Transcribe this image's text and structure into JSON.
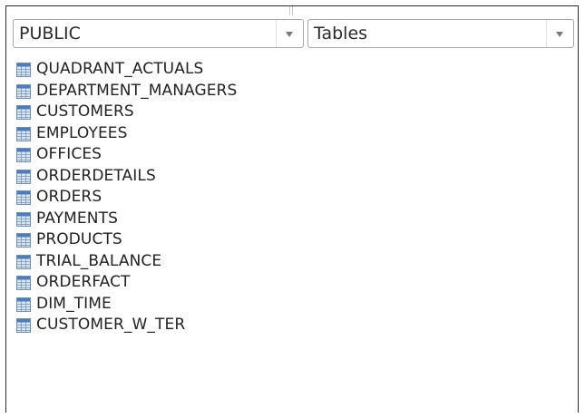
{
  "schema_select": {
    "value": "PUBLIC",
    "arrow_icon": "dropdown-arrow-icon"
  },
  "type_select": {
    "value": "Tables",
    "arrow_icon": "dropdown-arrow-icon"
  },
  "table_icon": "table-icon",
  "tables": [
    {
      "name": "QUADRANT_ACTUALS"
    },
    {
      "name": "DEPARTMENT_MANAGERS"
    },
    {
      "name": "CUSTOMERS"
    },
    {
      "name": "EMPLOYEES"
    },
    {
      "name": "OFFICES"
    },
    {
      "name": "ORDERDETAILS"
    },
    {
      "name": "ORDERS"
    },
    {
      "name": "PAYMENTS"
    },
    {
      "name": "PRODUCTS"
    },
    {
      "name": "TRIAL_BALANCE"
    },
    {
      "name": "ORDERFACT"
    },
    {
      "name": "DIM_TIME"
    },
    {
      "name": "CUSTOMER_W_TER"
    }
  ],
  "colors": {
    "border": "#2b2b2b",
    "select_border": "#a8a8a8",
    "text": "#222222",
    "icon_header": "#4a7cbf",
    "icon_body": "#d8e6f5"
  }
}
